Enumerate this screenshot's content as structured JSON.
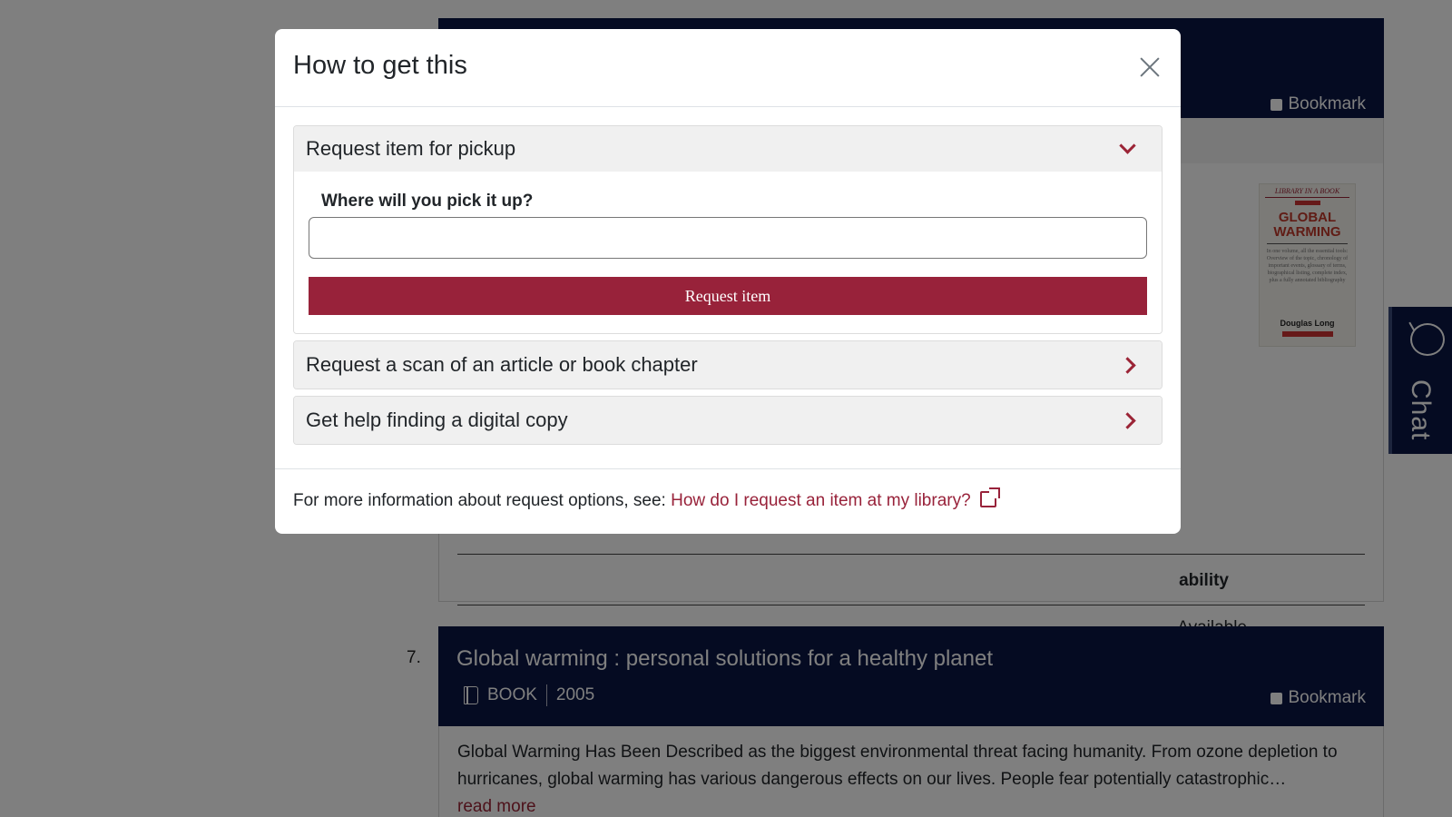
{
  "background": {
    "result6": {
      "bookmark_label": "Bookmark",
      "cover": {
        "series": "LIBRARY IN A BOOK",
        "title": "GLOBAL WARMING",
        "blurb": "In one volume, all the essential tools: Overview of the topic, chronology of important events, glossary of terms, biographical listing, complete index, plus a fully annotated bibliography",
        "author": "Douglas Long"
      },
      "availability_header": "ability",
      "availability_value": "Available"
    },
    "result7": {
      "number": "7.",
      "title": "Global warming : personal solutions for a healthy planet",
      "format": "BOOK",
      "year": "2005",
      "bookmark_label": "Bookmark",
      "description": "Global Warming Has Been Described as the biggest environmental threat facing humanity. From ozone depletion to hurricanes, global warming has various dangerous effects on our lives. People fear potentially catastrophic…",
      "read_more": "read more"
    },
    "chat_label": "Chat",
    "icons": [
      "book-icon",
      "chat-bubble-icon"
    ]
  },
  "modal": {
    "title": "How to get this",
    "close_icon": "close-icon",
    "options": [
      {
        "label": "Request item for pickup",
        "expanded": true,
        "field_label": "Where will you pick it up?",
        "field_value": "",
        "button_label": "Request item"
      },
      {
        "label": "Request a scan of an article or book chapter",
        "expanded": false
      },
      {
        "label": "Get help finding a digital copy",
        "expanded": false
      }
    ],
    "footer": {
      "text": "For more information about request options, see:",
      "link_text": "How do I request an item at my library?",
      "link_icon": "external-link-icon"
    }
  },
  "colors": {
    "navy": "#0b1744",
    "accent": "#98223a",
    "overlay": "rgba(0,0,0,0.5)"
  }
}
